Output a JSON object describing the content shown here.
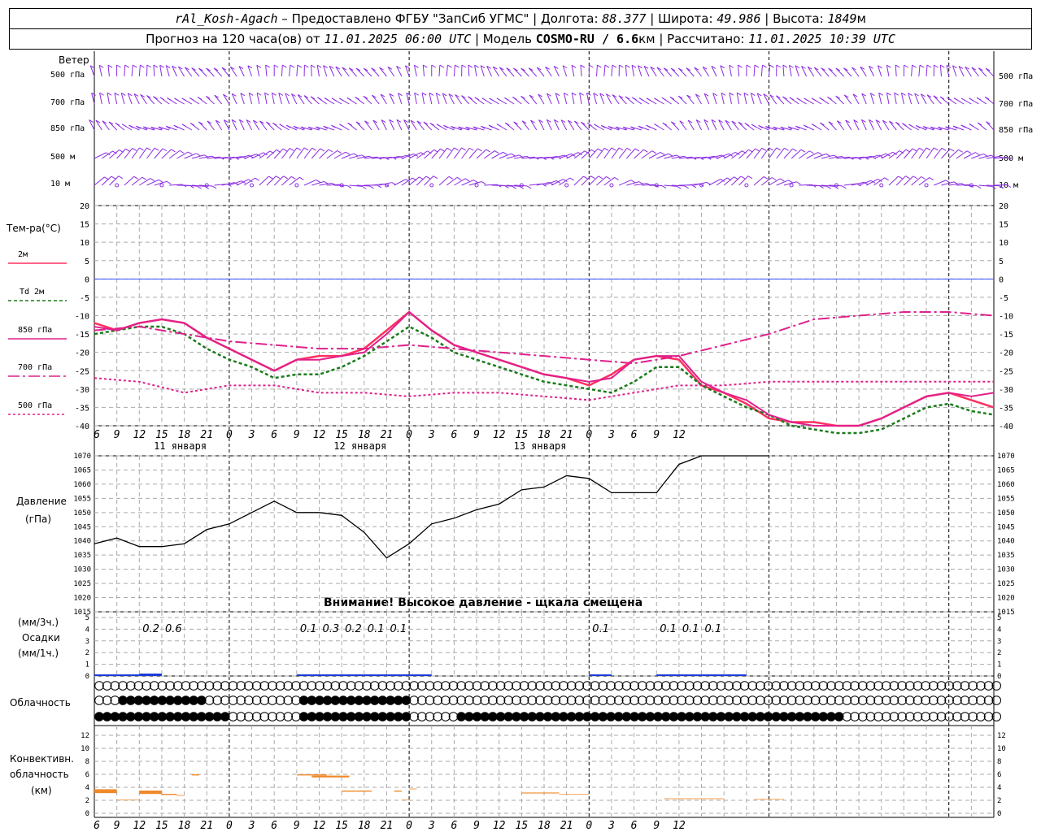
{
  "header": {
    "station": "rAl_Kosh-Agach",
    "provider": "Предоставлено ФГБУ \"ЗапСиб УГМС\"",
    "lon_label": "Долгота:",
    "lon": "88.377",
    "lat_label": "Широта:",
    "lat": "49.986",
    "alt_label": "Высота:",
    "alt": "1849",
    "alt_unit": "м",
    "forecast_label": "Прогноз на 120 часа(ов) от",
    "forecast_time": "11.01.2025 06:00 UTC",
    "model_label": "Модель",
    "model": "COSMO-RU / 6.6",
    "model_unit": "км",
    "computed_label": "Рассчитано:",
    "computed_time": "11.01.2025 10:39 UTC"
  },
  "wind_panel": {
    "title": "Ветер",
    "levels": [
      "500 гПа",
      "700 гПа",
      "850 гПа",
      "500 м",
      "10  м"
    ]
  },
  "temp_panel": {
    "title": "Тем-ра(°C)",
    "legend": [
      {
        "label": "2м",
        "color": "#ff3060",
        "style": "solid"
      },
      {
        "label": "Td  2м",
        "color": "#1a7a1a",
        "style": "dashed"
      },
      {
        "label": "850 гПа",
        "color": "#e0208c",
        "style": "solid"
      },
      {
        "label": "700 гПа",
        "color": "#e0208c",
        "style": "dashdot"
      },
      {
        "label": "500 гПа",
        "color": "#e0208c",
        "style": "dotted"
      }
    ],
    "yticks": [
      "20",
      "15",
      "10",
      "5",
      "0",
      "-5",
      "-10",
      "-15",
      "-20",
      "-25",
      "-30",
      "-35",
      "-40"
    ]
  },
  "time_axis": {
    "hours": [
      "6",
      "9",
      "12",
      "15",
      "18",
      "21",
      "0",
      "3",
      "6",
      "9",
      "12",
      "15",
      "18",
      "21",
      "0",
      "3",
      "6",
      "9",
      "12",
      "15",
      "18",
      "21",
      "0",
      "3",
      "6",
      "9",
      "12"
    ],
    "days": [
      "11 января",
      "12 января",
      "13 января"
    ]
  },
  "pressure_panel": {
    "title": "Давление",
    "unit": "(гПа)",
    "yticks": [
      "1070",
      "1065",
      "1060",
      "1055",
      "1050",
      "1045",
      "1040",
      "1035",
      "1030",
      "1025",
      "1020",
      "1015"
    ],
    "warning": "Внимание! Высокое давление - щкала смещена"
  },
  "precip_panel": {
    "unit_top": "(мм/3ч.)",
    "title": "Осадки",
    "unit_bottom": "(мм/1ч.)",
    "yticks": [
      "5",
      "4",
      "3",
      "2",
      "1",
      "0"
    ],
    "amounts": [
      {
        "h": 9,
        "text": "0.2"
      },
      {
        "h": 12,
        "text": "0.6"
      },
      {
        "h": 30,
        "text": "0.1"
      },
      {
        "h": 33,
        "text": "0.3"
      },
      {
        "h": 36,
        "text": "0.2"
      },
      {
        "h": 39,
        "text": "0.1"
      },
      {
        "h": 42,
        "text": "0.1"
      },
      {
        "h": 69,
        "text": "0.1"
      },
      {
        "h": 78,
        "text": "0.1"
      },
      {
        "h": 81,
        "text": "0.1"
      },
      {
        "h": 84,
        "text": "0.1"
      }
    ]
  },
  "cloud_panel": {
    "title": "Облачность"
  },
  "conv_panel": {
    "title_1": "Конвективн.",
    "title_2": "облачность",
    "unit": "(км)",
    "yticks": [
      "12",
      "10",
      "8",
      "6",
      "4",
      "2",
      "0"
    ]
  },
  "chart_data": {
    "type": "line",
    "x_unit": "forecast hour from 11.01.2025 06:00 UTC",
    "temperature": {
      "ylim": [
        -40,
        20
      ],
      "series": [
        {
          "name": "2м",
          "x": [
            0,
            3,
            6,
            9,
            12,
            15,
            18,
            21,
            24,
            27,
            30,
            33,
            36,
            39,
            42,
            45,
            48,
            51,
            54,
            57,
            60,
            63,
            66,
            69,
            72,
            75,
            78,
            81,
            84,
            87,
            90,
            93,
            96,
            99,
            102,
            105,
            108,
            111,
            114,
            117,
            120
          ],
          "y": [
            -12,
            -14,
            -12,
            -11,
            -12,
            -16,
            -19,
            -22,
            -25,
            -22,
            -21,
            -21,
            -19,
            -14,
            -9,
            -14,
            -18,
            -20,
            -22,
            -24,
            -26,
            -27,
            -29,
            -26,
            -22,
            -21,
            -22,
            -29,
            -31,
            -34,
            -38,
            -39,
            -39,
            -40,
            -40,
            -38,
            -35,
            -32,
            -31,
            -33,
            -35
          ]
        },
        {
          "name": "Td  2м",
          "x": [
            0,
            3,
            6,
            9,
            12,
            15,
            18,
            21,
            24,
            27,
            30,
            33,
            36,
            39,
            42,
            45,
            48,
            51,
            54,
            57,
            60,
            63,
            66,
            69,
            72,
            75,
            78,
            81,
            84,
            87,
            90,
            93,
            96,
            99,
            102,
            105,
            108,
            111,
            114,
            117,
            120
          ],
          "y": [
            -15,
            -14,
            -13,
            -13,
            -15,
            -19,
            -22,
            -24,
            -27,
            -26,
            -26,
            -24,
            -21,
            -17,
            -13,
            -16,
            -20,
            -22,
            -24,
            -26,
            -28,
            -29,
            -30,
            -31,
            -28,
            -24,
            -24,
            -29,
            -32,
            -35,
            -37,
            -40,
            -41,
            -42,
            -42,
            -41,
            -38,
            -35,
            -34,
            -36,
            -37
          ]
        },
        {
          "name": "850 гПа",
          "x": [
            0,
            3,
            6,
            9,
            12,
            15,
            18,
            21,
            24,
            27,
            30,
            33,
            36,
            39,
            42,
            45,
            48,
            51,
            54,
            57,
            60,
            63,
            66,
            69,
            72,
            75,
            78,
            81,
            84,
            87,
            90,
            93,
            96,
            99,
            102,
            105,
            108,
            111,
            114,
            117,
            120
          ],
          "y": [
            -13,
            -14,
            -12,
            -11,
            -12,
            -16,
            -19,
            -22,
            -25,
            -22,
            -22,
            -21,
            -20,
            -15,
            -9,
            -14,
            -18,
            -20,
            -22,
            -24,
            -26,
            -27,
            -28,
            -27,
            -22,
            -21,
            -21,
            -28,
            -31,
            -33,
            -37,
            -39,
            -40,
            -40,
            -40,
            -38,
            -35,
            -32,
            -31,
            -32,
            -31
          ]
        },
        {
          "name": "700 гПа",
          "x": [
            0,
            6,
            12,
            18,
            24,
            30,
            36,
            42,
            48,
            54,
            60,
            66,
            72,
            78,
            84,
            90,
            96,
            102,
            108,
            114,
            120
          ],
          "y": [
            -14,
            -13,
            -15,
            -17,
            -18,
            -19,
            -19,
            -18,
            -19,
            -20,
            -21,
            -22,
            -23,
            -21,
            -18,
            -15,
            -11,
            -10,
            -9,
            -9,
            -10
          ]
        },
        {
          "name": "500 гПа",
          "x": [
            0,
            6,
            12,
            18,
            24,
            30,
            36,
            42,
            48,
            54,
            60,
            66,
            72,
            78,
            84,
            90,
            96,
            102,
            108,
            114,
            120
          ],
          "y": [
            -27,
            -28,
            -31,
            -29,
            -29,
            -31,
            -31,
            -32,
            -31,
            -31,
            -32,
            -33,
            -31,
            -29,
            -29,
            -28,
            -28,
            -28,
            -28,
            -28,
            -28
          ]
        }
      ]
    },
    "pressure": {
      "ylim": [
        1015,
        1070
      ],
      "x": [
        0,
        3,
        6,
        9,
        12,
        15,
        18,
        21,
        24,
        27,
        30,
        33,
        36,
        39,
        42,
        45,
        48,
        51,
        54,
        57,
        60,
        63,
        66,
        69,
        72,
        75,
        78,
        81,
        84,
        87,
        90
      ],
      "y": [
        1039,
        1041,
        1038,
        1038,
        1039,
        1044,
        1046,
        1050,
        1054,
        1050,
        1050,
        1049,
        1043,
        1034,
        1039,
        1046,
        1048,
        1051,
        1053,
        1058,
        1059,
        1063,
        1062,
        1057,
        1057,
        1057,
        1067,
        1071,
        1071,
        1071,
        1071
      ]
    },
    "precip_3h": [
      0.2,
      0.2,
      0.6,
      0,
      0,
      0,
      0,
      0,
      0,
      0.1,
      0.3,
      0.3,
      0.2,
      0.1,
      0.1,
      0,
      0,
      0,
      0,
      0,
      0,
      0,
      0.1,
      0,
      0,
      0.1,
      0.1,
      0.1,
      0.1,
      0,
      0,
      0,
      0,
      0,
      0,
      0,
      0,
      0,
      0,
      0
    ],
    "convective_cloud_km": [
      {
        "x0": 0,
        "x1": 3,
        "base": 2,
        "top": 3.7
      },
      {
        "x0": 3,
        "x1": 6,
        "base": 2,
        "top": 2.1
      },
      {
        "x0": 6,
        "x1": 9,
        "base": 2,
        "top": 3.5
      },
      {
        "x0": 9,
        "x1": 11,
        "base": 2.5,
        "top": 3
      },
      {
        "x0": 11,
        "x1": 12,
        "base": 2.5,
        "top": 2.8
      },
      {
        "x0": 13,
        "x1": 14,
        "base": 5.5,
        "top": 6
      },
      {
        "x0": 27,
        "x1": 31,
        "base": 5.5,
        "top": 6
      },
      {
        "x0": 29,
        "x1": 34,
        "base": 5,
        "top": 5.8
      },
      {
        "x0": 33,
        "x1": 37,
        "base": 3,
        "top": 3.5
      },
      {
        "x0": 40,
        "x1": 41,
        "base": 3,
        "top": 3.5
      },
      {
        "x0": 41,
        "x1": 42,
        "base": 2,
        "top": 2.1
      },
      {
        "x0": 42,
        "x1": 43,
        "base": 3.5,
        "top": 3.8
      },
      {
        "x0": 57,
        "x1": 62,
        "base": 2.8,
        "top": 3.2
      },
      {
        "x0": 62,
        "x1": 66,
        "base": 2.8,
        "top": 3.0
      },
      {
        "x0": 76,
        "x1": 84,
        "base": 2,
        "top": 2.3
      },
      {
        "x0": 88,
        "x1": 92,
        "base": 2,
        "top": 2.2
      }
    ]
  }
}
